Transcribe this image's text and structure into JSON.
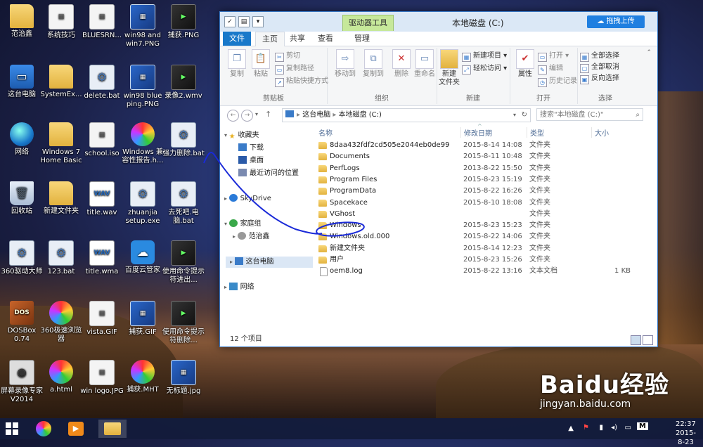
{
  "desktop": {
    "icons": [
      {
        "label": "范治鑫",
        "kind": "folder"
      },
      {
        "label": "系统技巧",
        "kind": "file"
      },
      {
        "label": "BLUESRN...",
        "kind": "file"
      },
      {
        "label": "win98 and win7.PNG",
        "kind": "img"
      },
      {
        "label": "捕获.PNG",
        "kind": "media"
      },
      {
        "label": "这台电脑",
        "kind": "pc"
      },
      {
        "label": "SystemEx...",
        "kind": "folder"
      },
      {
        "label": "delete.bat",
        "kind": "gear"
      },
      {
        "label": "win98 blue ping.PNG",
        "kind": "img"
      },
      {
        "label": "录像2.wmv",
        "kind": "media"
      },
      {
        "label": "网络",
        "kind": "globe"
      },
      {
        "label": "Windows 7 Home Basic",
        "kind": "folder"
      },
      {
        "label": "school.iso",
        "kind": "file"
      },
      {
        "label": "Windows 兼容性报告.h...",
        "kind": "pin"
      },
      {
        "label": "强力删除.bat",
        "kind": "gear"
      },
      {
        "label": "回收站",
        "kind": "bin"
      },
      {
        "label": "新建文件夹",
        "kind": "folder"
      },
      {
        "label": "title.wav",
        "kind": "wav"
      },
      {
        "label": "zhuanjia setup.exe",
        "kind": "gear"
      },
      {
        "label": "去死吧.电脑.bat",
        "kind": "gear"
      },
      {
        "label": "360驱动大师",
        "kind": "gear"
      },
      {
        "label": "123.bat",
        "kind": "gear"
      },
      {
        "label": "title.wma",
        "kind": "wav"
      },
      {
        "label": "百度云管家",
        "kind": "cloud"
      },
      {
        "label": "使用命令提示符进出...",
        "kind": "media"
      },
      {
        "label": "DOSBox 0.74",
        "kind": "dos"
      },
      {
        "label": "360极速浏览器",
        "kind": "pin"
      },
      {
        "label": "vista.GIF",
        "kind": "file"
      },
      {
        "label": "捕获.GIF",
        "kind": "img"
      },
      {
        "label": "使用命令提示符删除...",
        "kind": "media"
      },
      {
        "label": "屏幕录像专家V2014",
        "kind": "cam"
      },
      {
        "label": "a.html",
        "kind": "pin"
      },
      {
        "label": "win logo.JPG",
        "kind": "file"
      },
      {
        "label": "捕获.MHT",
        "kind": "pin"
      },
      {
        "label": "无标题.jpg",
        "kind": "img"
      }
    ]
  },
  "window": {
    "title": "本地磁盘 (C:)",
    "context_tab": "驱动器工具",
    "upload_button": "拖拽上传",
    "tabs": [
      "文件",
      "主页",
      "共享",
      "查看",
      "管理"
    ],
    "ribbon": {
      "clipboard": {
        "label": "剪贴板",
        "copy": "复制",
        "paste": "粘贴",
        "cut": "剪切",
        "copy_path": "复制路径",
        "paste_shortcut": "粘贴快捷方式"
      },
      "organize": {
        "label": "组织",
        "move_to": "移动到",
        "copy_to": "复制到",
        "delete": "删除",
        "rename": "重命名"
      },
      "new": {
        "label": "新建",
        "new_folder": "新建\n文件夹",
        "new_item": "新建项目 ▾",
        "easy_access": "轻松访问 ▾"
      },
      "open": {
        "label": "打开",
        "properties": "属性",
        "open": "打开 ▾",
        "edit": "编辑",
        "history": "历史记录"
      },
      "select": {
        "label": "选择",
        "select_all": "全部选择",
        "select_none": "全部取消",
        "invert": "反向选择"
      }
    },
    "address": {
      "crumbs": [
        "这台电脑",
        "本地磁盘 (C:)"
      ],
      "search_placeholder": "搜索\"本地磁盘 (C:)\""
    },
    "nav": {
      "favorites": "收藏夹",
      "downloads": "下载",
      "desktop": "桌面",
      "recent": "最近访问的位置",
      "skydrive": "SkyDrive",
      "homegroup": "家庭组",
      "user": "范治鑫",
      "this_pc": "这台电脑",
      "network": "网络"
    },
    "columns": {
      "name": "名称",
      "date": "修改日期",
      "type": "类型",
      "size": "大小"
    },
    "files": [
      {
        "name": "8daa432fdf2cd505e2044eb0de99",
        "date": "2015-8-14 14:08",
        "type": "文件夹",
        "size": "",
        "icon": "folder"
      },
      {
        "name": "Documents",
        "date": "2015-8-11 10:48",
        "type": "文件夹",
        "size": "",
        "icon": "folder"
      },
      {
        "name": "PerfLogs",
        "date": "2013-8-22 15:50",
        "type": "文件夹",
        "size": "",
        "icon": "folder"
      },
      {
        "name": "Program Files",
        "date": "2015-8-23 15:19",
        "type": "文件夹",
        "size": "",
        "icon": "folder"
      },
      {
        "name": "ProgramData",
        "date": "2015-8-22 16:26",
        "type": "文件夹",
        "size": "",
        "icon": "folder"
      },
      {
        "name": "Spacekace",
        "date": "2015-8-10 18:08",
        "type": "文件夹",
        "size": "",
        "icon": "folder"
      },
      {
        "name": "VGhost",
        "date": "",
        "type": "文件夹",
        "size": "",
        "icon": "folder"
      },
      {
        "name": "Windows",
        "date": "2015-8-23 15:23",
        "type": "文件夹",
        "size": "",
        "icon": "folder"
      },
      {
        "name": "Windows.old.000",
        "date": "2015-8-22 14:06",
        "type": "文件夹",
        "size": "",
        "icon": "folder"
      },
      {
        "name": "新建文件夹",
        "date": "2015-8-14 12:23",
        "type": "文件夹",
        "size": "",
        "icon": "folder"
      },
      {
        "name": "用户",
        "date": "2015-8-23 15:26",
        "type": "文件夹",
        "size": "",
        "icon": "folder"
      },
      {
        "name": "oem8.log",
        "date": "2015-8-22 13:16",
        "type": "文本文档",
        "size": "1 KB",
        "icon": "doc"
      }
    ],
    "status": "12 个项目"
  },
  "taskbar": {
    "time": "22:37",
    "date": "2015-8-23",
    "ime": "M"
  },
  "watermark": {
    "main": "Baidu经验",
    "sub": "jingyan.baidu.com"
  }
}
